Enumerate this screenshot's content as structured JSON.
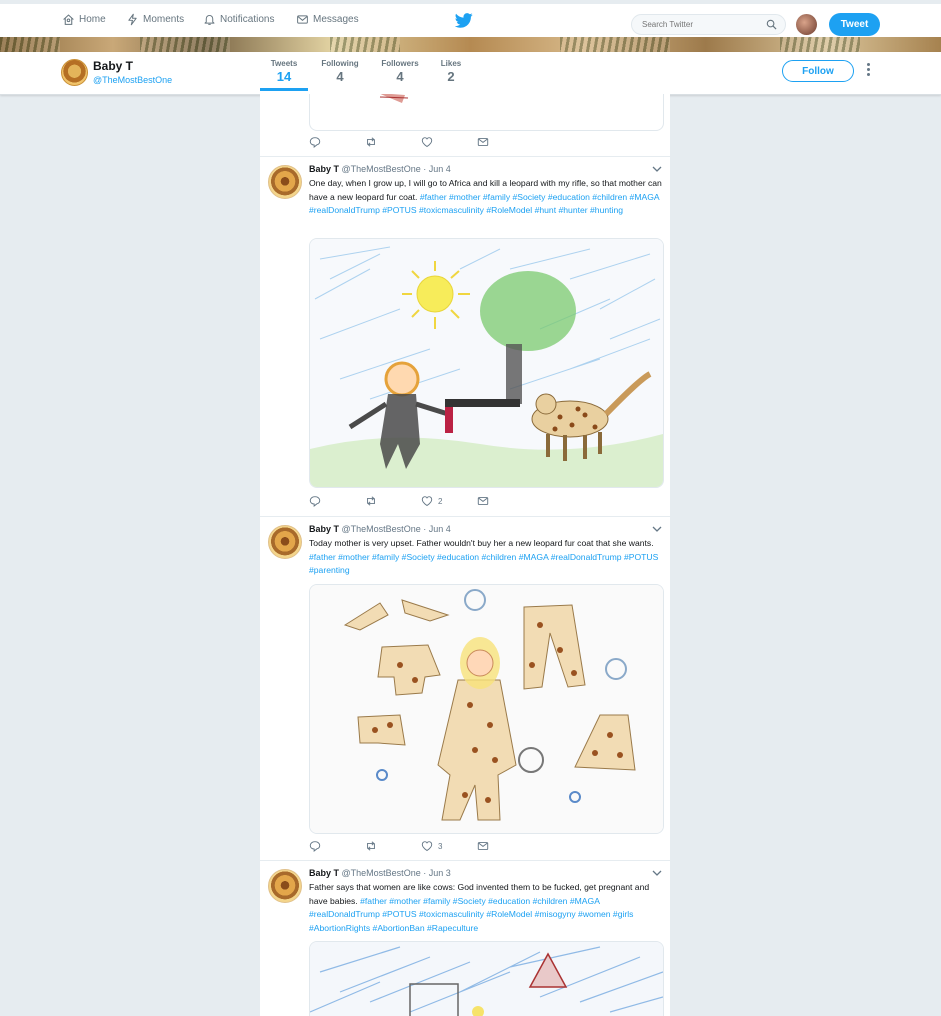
{
  "nav": {
    "home": "Home",
    "moments": "Moments",
    "notifications": "Notifications",
    "messages": "Messages",
    "search_placeholder": "Search Twitter",
    "tweet_button": "Tweet"
  },
  "profile": {
    "name": "Baby T",
    "handle": "@TheMostBestOne",
    "stats": [
      {
        "label": "Tweets",
        "value": "14"
      },
      {
        "label": "Following",
        "value": "4"
      },
      {
        "label": "Followers",
        "value": "4"
      },
      {
        "label": "Likes",
        "value": "2"
      }
    ],
    "follow_button": "Follow"
  },
  "tweets": [
    {
      "name": "Baby T",
      "meta": "@TheMostBestOne · Jun 4",
      "text": "One day, when I grow up, I will go to Africa and kill a leopard with my rifle, so that mother can have a new leopard fur coat.",
      "hashtags": " #father #mother #family #Society #education #children #MAGA #realDonaldTrump #POTUS #toxicmasculinity #RoleModel #hunt #hunter  #hunting",
      "likes": "2",
      "image": "child-drawing-boy-leopard"
    },
    {
      "name": "Baby T",
      "meta": "@TheMostBestOne · Jun 4",
      "text": "Today mother is very upset. Father wouldn't buy her a new leopard fur coat that she wants. ",
      "hashtags": " #father #mother #family #Society #education #children #MAGA #realDonaldTrump #POTUS #parenting",
      "likes": "3",
      "image": "child-drawing-leopard-clothes"
    },
    {
      "name": "Baby T",
      "meta": "@TheMostBestOne · Jun 3",
      "text": "Father says that women are like cows: God invented them to be fucked, get pregnant and have babies.",
      "hashtags": " #father #mother #family #Society #education #children #MAGA #realDonaldTrump #POTUS #toxicmasculinity #RoleModel #misogyny #women #girls #AbortionRights #AbortionBan #Rapeculture",
      "likes": "",
      "image": "child-drawing-house"
    }
  ],
  "colors": {
    "accent": "#1da1f2",
    "background": "#e6ecf0",
    "muted": "#657786"
  }
}
